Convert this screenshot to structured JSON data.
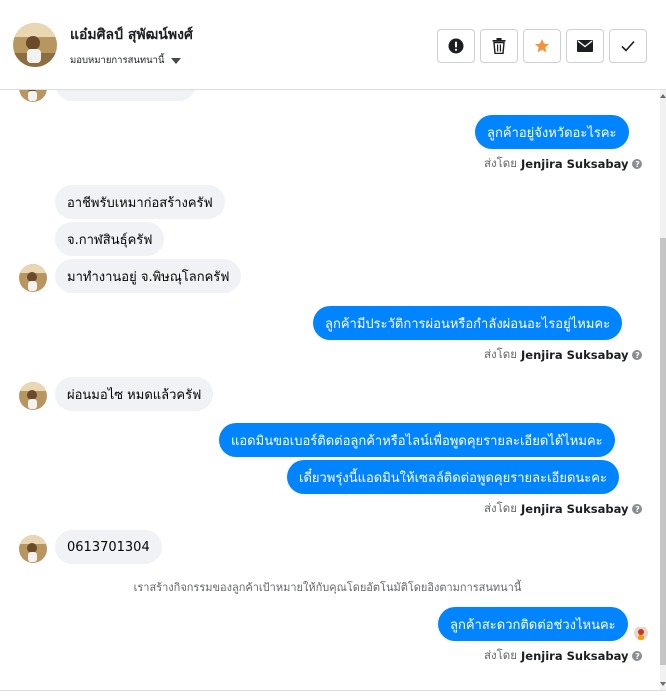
{
  "header": {
    "contact_name": "แอ๋มศิลป์ สุพัฒน์พงศ์",
    "assign_label": "มอบหมายการสนทนานี้",
    "actions": [
      "mark-spam",
      "delete",
      "star",
      "mark-unread",
      "mark-done"
    ]
  },
  "conversation": {
    "msg_out_1": "ลูกค้าอยู่จังหวัดอะไรคะ",
    "msg_in_1": "อาชีพรับเหมาก่อสร้างครัฟ",
    "msg_in_2": "จ.กาฬสินธุ์ครัฟ",
    "msg_in_3": "มาทำงานอยู่ จ.พิษณุโลกครัฟ",
    "msg_out_2": "ลูกค้ามีประวัติการผ่อนหรือกำลังผ่อนอะไรอยู่ไหมคะ",
    "msg_in_4": "ผ่อนมอไซ หมดแล้วครัฟ",
    "msg_out_3": "แอดมินขอเบอร์ติดต่อลูกค้าหรือไลน์เพื่อพูดคุยรายละเอียดได้ไหมคะ",
    "msg_out_4": "เดี๋ยวพรุ่งนี้แอดมินให้เซลล์ติดต่อพูดคุยรายละเอียดนะคะ",
    "msg_in_5": "0613701304",
    "system_note": "เราสร้างกิจกรรมของลูกค้าเป้าหมายให้กับคุณโดยอัตโนมัติโดยอิงตามการสนทนานี้",
    "msg_out_5": "ลูกค้าสะดวกติดต่อช่วงไหนคะ",
    "sent_by_prefix": "ส่งโดย",
    "sent_by_name": "Jenjira Suksabay"
  },
  "colors": {
    "outgoing_bubble": "#0084ff",
    "incoming_bubble": "#f0f2f5",
    "star": "#f7923a"
  }
}
